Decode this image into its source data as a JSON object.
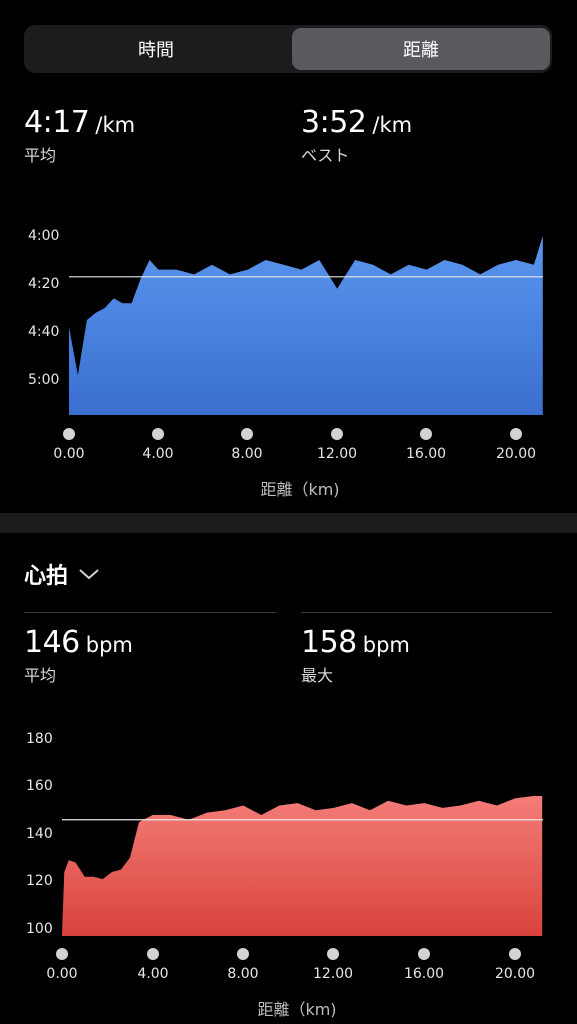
{
  "segment": {
    "time_label": "時間",
    "distance_label": "距離",
    "selected": "distance"
  },
  "pace": {
    "avg": {
      "value": "4:17",
      "unit": "/km",
      "label": "平均"
    },
    "best": {
      "value": "3:52",
      "unit": "/km",
      "label": "ベスト"
    }
  },
  "heart": {
    "title": "心拍",
    "avg": {
      "value": "146",
      "unit": "bpm",
      "label": "平均"
    },
    "max": {
      "value": "158",
      "unit": "bpm",
      "label": "最大"
    }
  },
  "chart_data": [
    {
      "type": "area",
      "name": "pace",
      "color": "#4a84e0",
      "y_ticks": [
        "4:00",
        "4:20",
        "4:40",
        "5:00"
      ],
      "x_ticks": [
        "0.00",
        "4.00",
        "8.00",
        "12.00",
        "16.00",
        "20.00"
      ],
      "xlabel": "距離（km)",
      "average_line_seconds_per_km": 257,
      "ylim_seconds_per_km": [
        232,
        312
      ],
      "y_inverted": true,
      "x": [
        0,
        0.4,
        0.8,
        1.2,
        1.6,
        2,
        2.4,
        2.8,
        3.2,
        3.6,
        4,
        4.8,
        5.6,
        6.4,
        7.2,
        8,
        8.8,
        9.6,
        10.4,
        11.2,
        12,
        12.8,
        13.6,
        14.4,
        15.2,
        16,
        16.8,
        17.6,
        18.4,
        19.2,
        20,
        20.8,
        21.2
      ],
      "y": [
        278,
        298,
        275,
        272,
        270,
        266,
        268,
        268,
        258,
        250,
        254,
        254,
        256,
        252,
        256,
        254,
        250,
        252,
        254,
        250,
        262,
        250,
        252,
        256,
        252,
        254,
        250,
        252,
        256,
        252,
        250,
        252,
        240
      ]
    },
    {
      "type": "area",
      "name": "heart_rate",
      "color": "#e35b56",
      "y_ticks": [
        "180",
        "160",
        "140",
        "120",
        "100"
      ],
      "x_ticks": [
        "0.00",
        "4.00",
        "8.00",
        "12.00",
        "16.00",
        "20.00"
      ],
      "xlabel": "距離（km)",
      "average_line_bpm": 146,
      "ylim_bpm": [
        96,
        184
      ],
      "x": [
        0,
        0.1,
        0.3,
        0.6,
        1,
        1.4,
        1.8,
        2.2,
        2.6,
        3,
        3.4,
        3.6,
        4,
        4.8,
        5.6,
        6.4,
        7.2,
        8,
        8.8,
        9.6,
        10.4,
        11.2,
        12,
        12.8,
        13.6,
        14.4,
        15.2,
        16,
        16.8,
        17.6,
        18.4,
        19.2,
        20,
        20.8,
        21.2
      ],
      "y": [
        98,
        124,
        129,
        128,
        122,
        122,
        121,
        124,
        125,
        130,
        145,
        146,
        148,
        148,
        146,
        149,
        150,
        152,
        148,
        152,
        153,
        150,
        151,
        153,
        150,
        154,
        152,
        153,
        151,
        152,
        154,
        152,
        155,
        156,
        156
      ]
    }
  ]
}
